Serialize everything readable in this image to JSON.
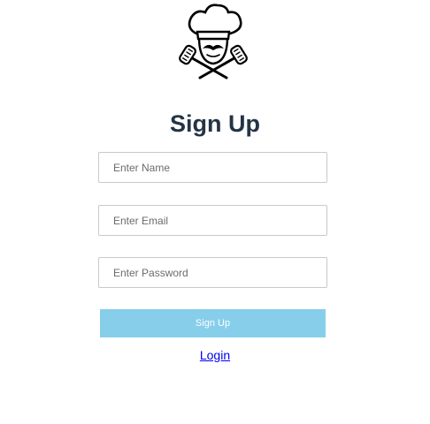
{
  "logo": {
    "icon": "chef-hat-crossed-spatulas-icon"
  },
  "form": {
    "title": "Sign Up",
    "name_placeholder": "Enter Name",
    "email_placeholder": "Enter Email",
    "password_placeholder": "Enter Password",
    "submit_label": "Sign Up",
    "login_link": "Login"
  },
  "colors": {
    "title": "#243447",
    "submit_background": "#87ceeb",
    "link": "#0000ee"
  }
}
